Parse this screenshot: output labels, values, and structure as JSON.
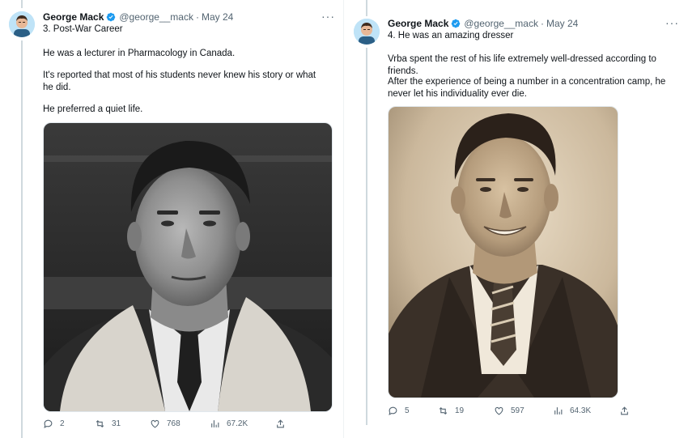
{
  "left_tweet": {
    "author_name": "George Mack",
    "handle": "@george__mack",
    "dot": "·",
    "date": "May 24",
    "more": "···",
    "title": "3. Post-War Career",
    "paragraphs": [
      "He was a lecturer in Pharmacology in Canada.",
      "It's reported that most of his students never knew his story or what he did.",
      "He preferred a quiet life."
    ],
    "actions": {
      "replies": "2",
      "retweets": "31",
      "likes": "768",
      "views": "67.2K"
    }
  },
  "right_tweet": {
    "author_name": "George Mack",
    "handle": "@george__mack",
    "dot": "·",
    "date": "May 24",
    "more": "···",
    "title": "4. He was an amazing dresser",
    "paragraphs": [
      "Vrba spent the rest of his life extremely well-dressed according to friends.",
      "After the experience of being a number in a concentration camp, he never let his individuality ever die."
    ],
    "actions": {
      "replies": "5",
      "retweets": "19",
      "likes": "597",
      "views": "64.3K"
    }
  },
  "colors": {
    "verified": "#1d9bf0",
    "muted": "#536471",
    "text": "#0f1419",
    "thread_line": "#cfd9de"
  }
}
